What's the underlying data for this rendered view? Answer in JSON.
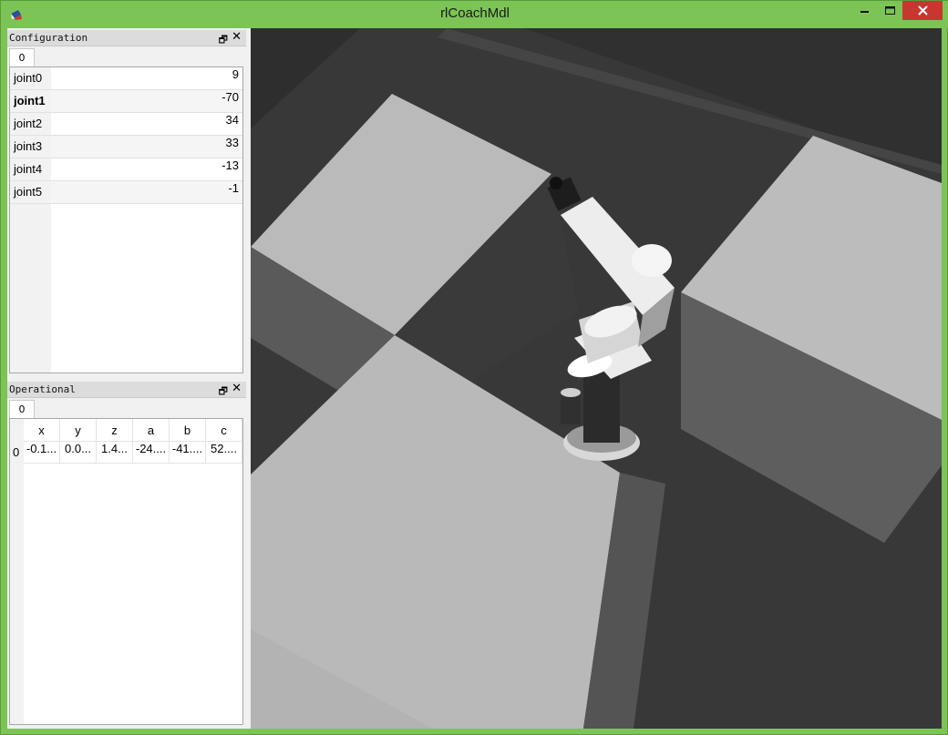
{
  "window": {
    "title": "rlCoachMdl",
    "icon": "robot-app-icon",
    "buttons": {
      "minimize": "—",
      "maximize": "□",
      "close": "✕"
    }
  },
  "configuration": {
    "title": "Configuration",
    "tab": "0",
    "float_icon": "🗗",
    "close_icon": "✕",
    "joints": [
      {
        "label": "joint0",
        "value": "9",
        "selected": false
      },
      {
        "label": "joint1",
        "value": "-70",
        "selected": true
      },
      {
        "label": "joint2",
        "value": "34",
        "selected": false
      },
      {
        "label": "joint3",
        "value": "33",
        "selected": false
      },
      {
        "label": "joint4",
        "value": "-13",
        "selected": false
      },
      {
        "label": "joint5",
        "value": "-1",
        "selected": false
      }
    ]
  },
  "operational": {
    "title": "Operational",
    "tab": "0",
    "float_icon": "🗗",
    "close_icon": "✕",
    "columns": [
      "x",
      "y",
      "z",
      "a",
      "b",
      "c"
    ],
    "rows": [
      {
        "label": "0",
        "cells": [
          "-0.1...",
          "0.0...",
          "1.4...",
          "-24....",
          "-41....",
          "52...."
        ]
      }
    ]
  },
  "viewport": {
    "background": "#383838",
    "scene": "3d-robot-arm-scene"
  }
}
